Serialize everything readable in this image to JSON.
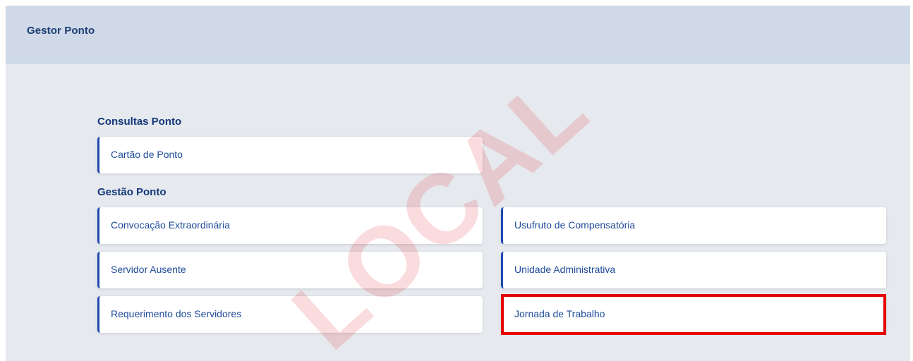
{
  "header": {
    "title": "Gestor Ponto"
  },
  "sections": {
    "consultas": {
      "title": "Consultas Ponto",
      "items": [
        "Cartão de Ponto"
      ]
    },
    "gestao": {
      "title": "Gestão Ponto",
      "items": [
        "Convocação Extraordinária",
        "Usufruto de Compensatória",
        "Servidor Ausente",
        "Unidade Administrativa",
        "Requerimento dos Servidores",
        "Jornada de Trabalho"
      ]
    }
  },
  "watermark": "LOCAL",
  "highlighted_item": "Jornada de Trabalho",
  "colors": {
    "header_bg": "#cfd9e7",
    "page_bg": "#e6e9ee",
    "accent": "#1d49b0",
    "highlight": "#e60000"
  }
}
